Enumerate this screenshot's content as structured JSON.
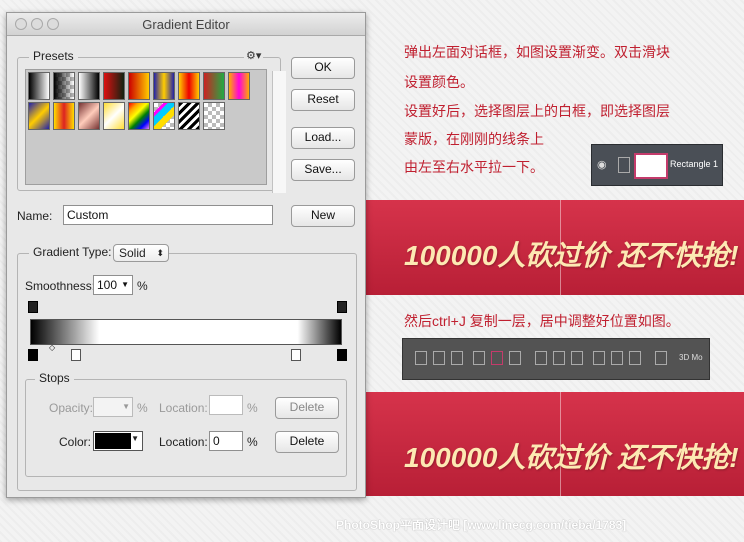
{
  "dialog": {
    "title": "Gradient Editor",
    "presets_label": "Presets",
    "name_label": "Name:",
    "name_value": "Custom",
    "buttons": {
      "ok": "OK",
      "reset": "Reset",
      "load": "Load...",
      "save": "Save...",
      "new": "New",
      "delete": "Delete"
    },
    "gradient_type_label": "Gradient Type:",
    "gradient_type_value": "Solid",
    "smoothness_label": "Smoothness:",
    "smoothness_value": "100",
    "percent": "%",
    "stops_label": "Stops",
    "opacity_label": "Opacity:",
    "location_label": "Location:",
    "color_label": "Color:",
    "color_location_value": "0",
    "stop_color": "#000000"
  },
  "instructions": {
    "line1": "弹出左面对话框，如图设置渐变。双击滑块",
    "line2": "设置颜色。",
    "line3": "设置好后，选择图层上的白框，即选择图层",
    "line4": "蒙版，在刚刚的线条上",
    "line5": "由左至右水平拉一下。",
    "line6": "然后ctrl+J 复制一层，居中调整好位置如图。"
  },
  "layer_panel": {
    "layer_name": "Rectangle 1"
  },
  "align_toolbar": {
    "mode_label": "3D Mo"
  },
  "banner": {
    "text": "100000人砍过价 还不快抢!"
  },
  "watermark": "PhotoShop平面设计吧 [www.linecg.com/tieba/1783]",
  "colors": {
    "banner_red": "#c8283f",
    "banner_text": "#fde9b3",
    "note_red": "#c02030"
  }
}
